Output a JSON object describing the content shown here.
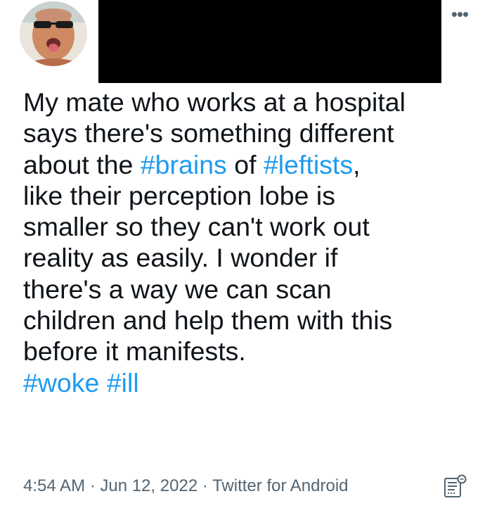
{
  "tweet": {
    "avatar_icon": "user-avatar-photo",
    "more_icon": "more-options-icon",
    "more_label": "•••",
    "text": {
      "line1": "My mate who works at a hospital",
      "line2": "says there's something different",
      "line3_pre": "about the ",
      "hashtag_brains": "#brains",
      "line3_mid": " of ",
      "hashtag_leftists": "#leftists",
      "line3_post": ",",
      "line4": "like their perception lobe is",
      "line5": "smaller so they can't work out",
      "line6": "reality as easily. I wonder if",
      "line7": "there's a way we can scan",
      "line8": "children and help them with this",
      "line9": "before it manifests.",
      "hashtag_woke": "#woke",
      "hashtag_ill": "#ill"
    },
    "meta": {
      "time": "4:54 AM",
      "separator": " · ",
      "date": "Jun 12, 2022",
      "source": "Twitter for Android"
    },
    "analytics_icon": "tweet-analytics-icon"
  },
  "colors": {
    "text": "#0f1419",
    "hashtag": "#1d9bf0",
    "meta": "#536471",
    "redaction": "#000000"
  }
}
